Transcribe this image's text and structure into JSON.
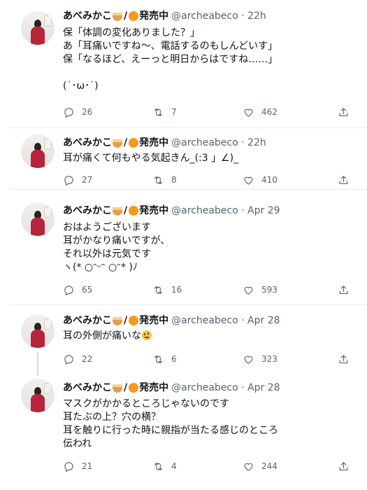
{
  "author": {
    "name": "あべみかこ",
    "name_suffix": "発売中",
    "handle": "@archeabeco"
  },
  "tweets": [
    {
      "time": "22h",
      "lines": [
        "保「体調の変化ありました？」",
        "あ「耳痛いですね～、電話するのもしんどいす」",
        "保「なるほど、えーっと明日からはですね……」",
        "",
        "(˙･ω･˙)"
      ],
      "replies": "26",
      "retweets": "7",
      "likes": "462"
    },
    {
      "time": "22h",
      "lines": [
        "耳が痛くて何もやる気起きん_(:3 」∠)_"
      ],
      "replies": "27",
      "retweets": "8",
      "likes": "410"
    },
    {
      "time": "Apr 29",
      "lines": [
        "おはようございます",
        "耳がかなり痛いですが、",
        "それ以外は元気です",
        "ヽ(* ○ᵔᵕᵔ ○ᵔ* )ﾉ"
      ],
      "replies": "65",
      "retweets": "16",
      "likes": "593"
    },
    {
      "time": "Apr 28",
      "lines": [
        "耳の外側が痛いな"
      ],
      "trailing_emoji": "thinking-face-emoji",
      "replies": "22",
      "retweets": "6",
      "likes": "323"
    },
    {
      "time": "Apr 28",
      "lines": [
        "マスクがかかるところじゃないのです",
        "耳たぶの上？穴の横？",
        "耳を触りに行った時に親指が当たる感じのところ",
        "伝われ"
      ],
      "replies": "21",
      "retweets": "4",
      "likes": "244"
    }
  ],
  "icons": {
    "reply": "reply-icon",
    "retweet": "retweet-icon",
    "like": "heart-icon",
    "share": "share-icon"
  },
  "colors": {
    "text": "#0f1419",
    "secondary": "#536471",
    "divider": "#e6ecf0",
    "thread_line": "#cfd9de"
  }
}
